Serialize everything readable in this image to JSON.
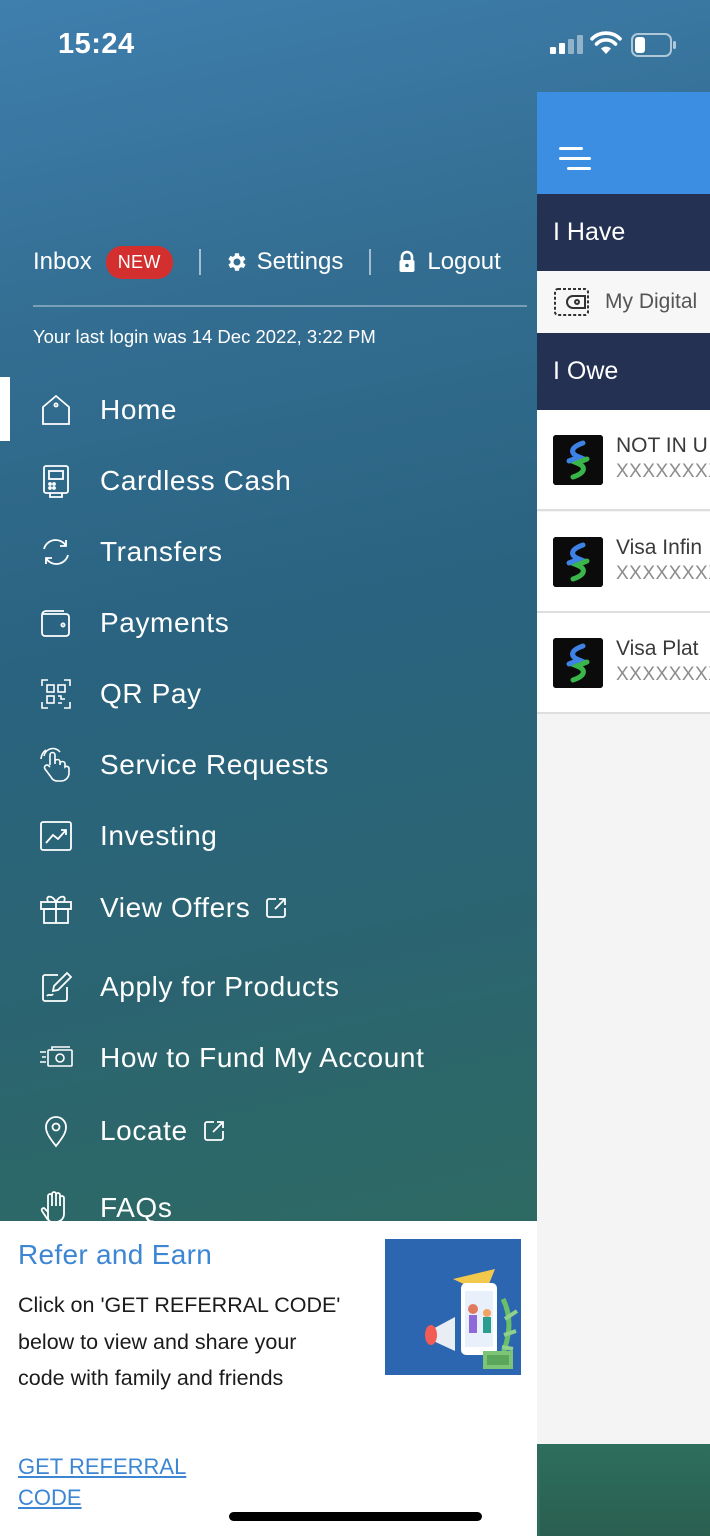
{
  "status_bar": {
    "time": "15:24"
  },
  "top_links": {
    "inbox": "Inbox",
    "inbox_badge": "NEW",
    "settings": "Settings",
    "logout": "Logout"
  },
  "last_login": "Your last login was 14 Dec 2022, 3:22 PM",
  "menu": [
    {
      "label": "Home",
      "icon": "home-icon",
      "active": true
    },
    {
      "label": "Cardless Cash",
      "icon": "atm-icon"
    },
    {
      "label": "Transfers",
      "icon": "transfer-icon"
    },
    {
      "label": "Payments",
      "icon": "wallet-icon"
    },
    {
      "label": "QR Pay",
      "icon": "qr-code-icon"
    },
    {
      "label": "Service Requests",
      "icon": "hand-pointer-icon"
    },
    {
      "label": "Investing",
      "icon": "chart-up-icon"
    },
    {
      "label": "View Offers",
      "icon": "gift-icon",
      "external": true
    },
    {
      "label": "Apply for Products",
      "icon": "edit-form-icon"
    },
    {
      "label": "How to Fund My Account",
      "icon": "cash-icon"
    },
    {
      "label": "Locate",
      "icon": "location-pin-icon",
      "external": true
    },
    {
      "label": "FAQs",
      "icon": "hand-raise-icon"
    }
  ],
  "refer": {
    "title": "Refer and Earn",
    "body": "Click on 'GET REFERRAL CODE' below to view and share your code with family and friends",
    "link": "GET REFERRAL CODE"
  },
  "right_panel": {
    "i_have": "I Have",
    "wallet_label": "My Digital",
    "i_owe": "I Owe",
    "accounts": [
      {
        "name": "NOT IN U",
        "number": "XXXXXXXX"
      },
      {
        "name": "Visa Infin",
        "number": "XXXXXXXX"
      },
      {
        "name": "Visa Plat",
        "number": "XXXXXXXX"
      }
    ]
  },
  "colors": {
    "brand_blue": "#3c8ee3",
    "navy": "#243152",
    "badge_red": "#d32f2f",
    "link_blue": "#3d86d3"
  }
}
